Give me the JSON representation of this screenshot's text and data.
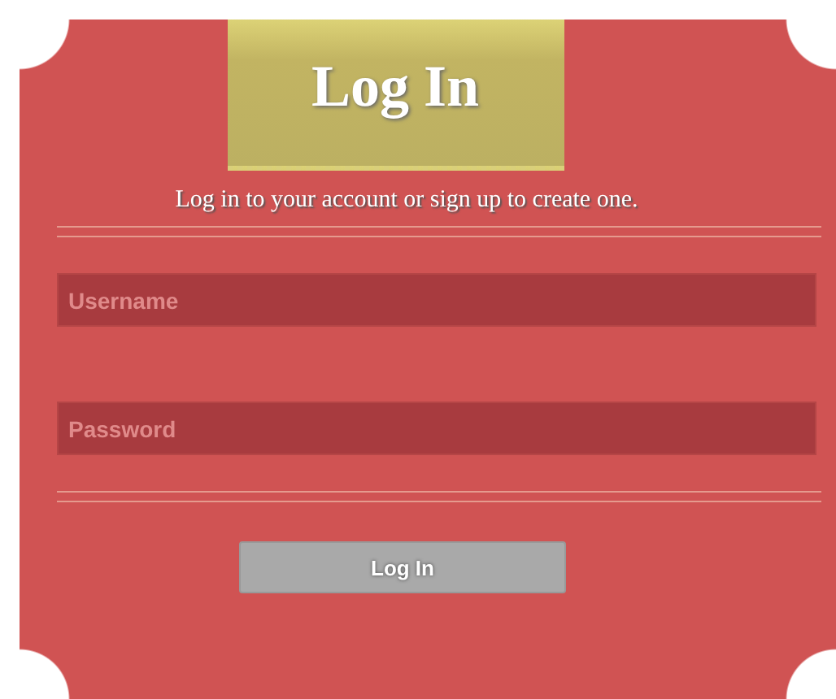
{
  "title": "Log In",
  "subtitle": "Log in to your account or sign up to create one.",
  "fields": [
    {
      "placeholder": "Username"
    },
    {
      "placeholder": "Password"
    }
  ],
  "button": "Log In"
}
